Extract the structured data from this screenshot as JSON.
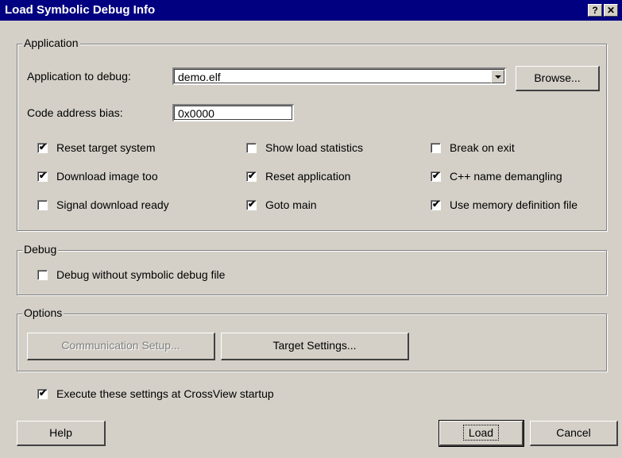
{
  "window": {
    "title": "Load Symbolic Debug Info",
    "help_glyph": "?",
    "close_glyph": "✕"
  },
  "application": {
    "legend": "Application",
    "app_label": "Application to debug:",
    "app_value": "demo.elf",
    "browse": "Browse...",
    "bias_label": "Code address bias:",
    "bias_value": "0x0000",
    "checkboxes": [
      {
        "label": "Reset target system",
        "checked": true
      },
      {
        "label": "Show load statistics",
        "checked": false
      },
      {
        "label": "Break on exit",
        "checked": false
      },
      {
        "label": "Download image too",
        "checked": true
      },
      {
        "label": "Reset application",
        "checked": true
      },
      {
        "label": "C++ name demangling",
        "checked": true
      },
      {
        "label": "Signal download ready",
        "checked": false
      },
      {
        "label": "Goto main",
        "checked": true
      },
      {
        "label": "Use memory definition file",
        "checked": true
      }
    ]
  },
  "debug": {
    "legend": "Debug",
    "no_symbolic": {
      "label": "Debug without symbolic debug file",
      "checked": false
    }
  },
  "options": {
    "legend": "Options",
    "comm_setup": "Communication Setup...",
    "target_settings": "Target Settings..."
  },
  "startup": {
    "label": "Execute these settings at CrossView startup",
    "checked": true
  },
  "footer": {
    "help": "Help",
    "load": "Load",
    "cancel": "Cancel"
  },
  "check_glyph": "✔"
}
